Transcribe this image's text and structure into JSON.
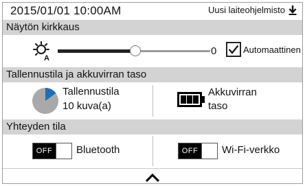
{
  "status_bar": {
    "datetime": "2015/01/01  10:00AM",
    "update_label": "Uusi laiteohjelmisto",
    "update_icon": "download-arrow-icon"
  },
  "brightness": {
    "header": "Näytön kirkkaus",
    "icon": "brightness-auto-icon",
    "level_fraction": 0.51,
    "value": "0",
    "auto_checked": true,
    "auto_label": "Automaattinen"
  },
  "storage": {
    "header": "Tallennustila ja akkuvirran taso",
    "storage_label": "Tallennustila",
    "storage_count": "10 kuva(a)",
    "used_fraction": 0.15,
    "battery_label_line1": "Akkuvirran",
    "battery_label_line2": "taso",
    "battery_level": "full"
  },
  "connection": {
    "header": "Yhteyden tila",
    "bluetooth_state": "OFF",
    "bluetooth_label": "Bluetooth",
    "wifi_state": "OFF",
    "wifi_label": "Wi-Fi-verkko"
  },
  "colors": {
    "section_header_bg": "#d3d3d3",
    "pie_used": "#1f6fb4",
    "pie_free": "#a9a9a9"
  },
  "footer": {
    "collapse_icon": "chevron-up-icon"
  }
}
